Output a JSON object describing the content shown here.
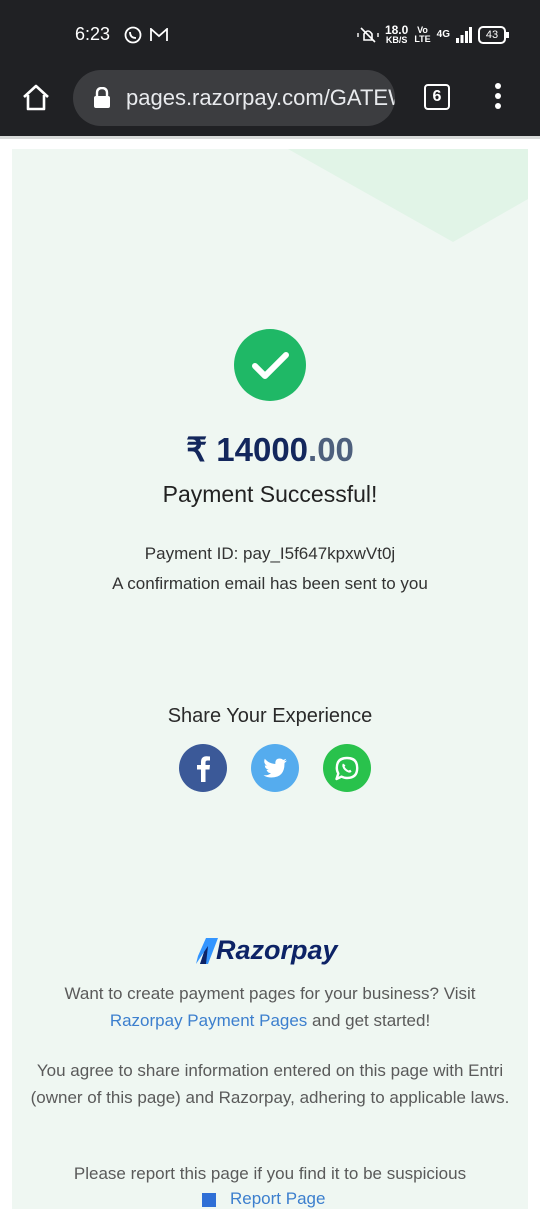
{
  "status_bar": {
    "time": "6:23",
    "network_speed": "18.0",
    "network_speed_unit": "KB/S",
    "volte_top": "Vo",
    "volte_bottom": "LTE",
    "net_type": "4G",
    "battery": "43"
  },
  "browser": {
    "url": "pages.razorpay.com/GATEWAY",
    "tab_count": "6"
  },
  "payment": {
    "currency_symbol": "₹",
    "amount_whole": "14000",
    "amount_decimal": ".00",
    "status": "Payment Successful!",
    "payment_id_line": "Payment ID: pay_I5f647kpxwVt0j",
    "confirmation": "A confirmation email has been sent to you"
  },
  "share": {
    "title": "Share Your Experience",
    "icons": [
      "facebook-icon",
      "twitter-icon",
      "whatsapp-icon"
    ]
  },
  "footer": {
    "brand": "Razorpay",
    "promo_prefix": "Want to create payment pages for your business? Visit ",
    "promo_link": "Razorpay Payment Pages",
    "promo_suffix": " and get started!",
    "agreement": "You agree to share information entered on this page with Entri (owner of this page) and Razorpay, adhering to applicable laws.",
    "report_prompt": "Please report this page if you find it to be suspicious",
    "report_link": "Report Page"
  },
  "colors": {
    "card_bg": "#eff7f2",
    "success_green": "#1fb866",
    "amount_navy": "#13275c",
    "link_blue": "#3c7fce",
    "facebook": "#3b5998",
    "twitter": "#55acee",
    "whatsapp": "#29c24c"
  }
}
